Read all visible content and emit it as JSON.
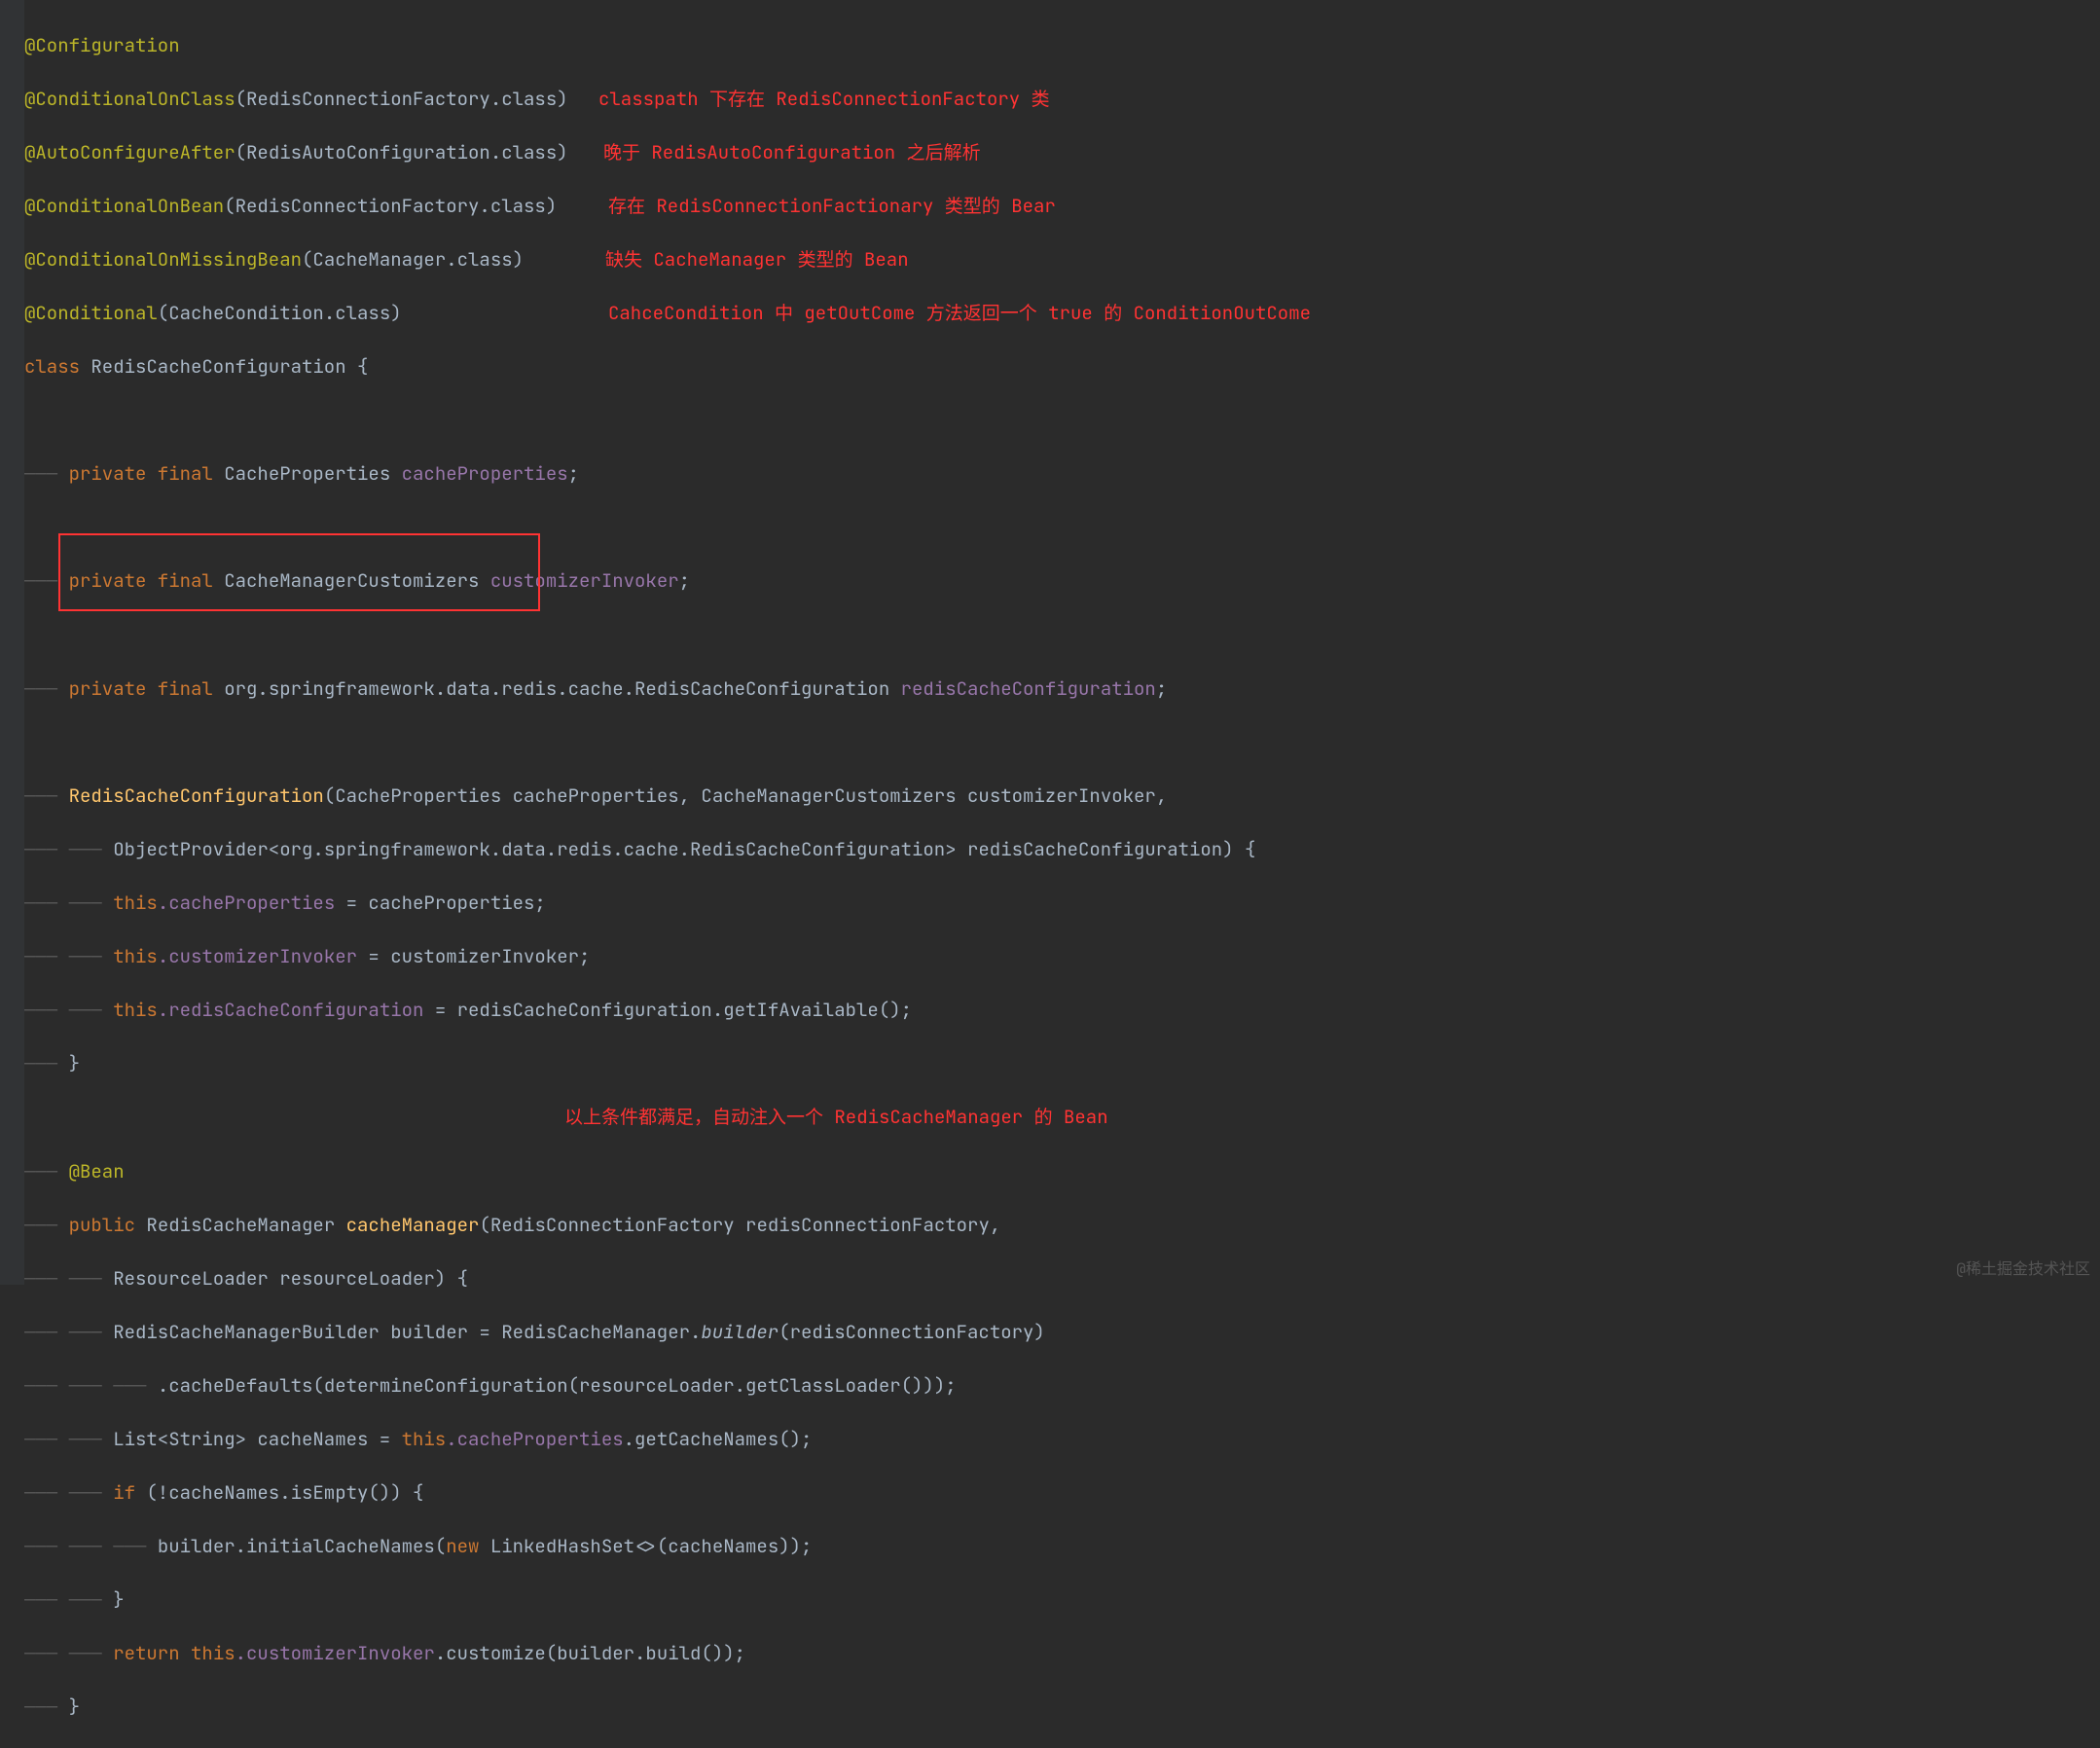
{
  "code": {
    "anno1": "@Configuration",
    "anno2": "@ConditionalOnClass",
    "anno2_arg_type": "RedisConnectionFactory",
    "anno3": "@AutoConfigureAfter",
    "anno3_arg_type": "RedisAutoConfiguration",
    "anno4": "@ConditionalOnBean",
    "anno4_arg_type": "RedisConnectionFactory",
    "anno5": "@ConditionalOnMissingBean",
    "anno5_arg_type": "CacheManager",
    "anno6": "@Conditional",
    "anno6_arg_type": "CacheCondition",
    "class_decl_kw": "class ",
    "class_decl_name": "RedisCacheConfiguration {",
    "field1_mods": "private final ",
    "field1_type": "CacheProperties ",
    "field1_name": "cacheProperties",
    "field2_mods": "private final ",
    "field2_type": "CacheManagerCustomizers ",
    "field2_name": "customizerInvoker",
    "field3_mods": "private final ",
    "field3_type": "org.springframework.data.redis.cache.RedisCacheConfiguration ",
    "field3_name": "redisCacheConfiguration",
    "ctor_name": "RedisCacheConfiguration",
    "ctor_params_l1": "(CacheProperties cacheProperties, CacheManagerCustomizers customizerInvoker,",
    "ctor_params_l2": "ObjectProvider<org.springframework.data.redis.cache.RedisCacheConfiguration> redisCacheConfiguration) {",
    "ctor_body1_this": "this",
    "ctor_body1_field": ".cacheProperties",
    "ctor_body1_rest": " = cacheProperties;",
    "ctor_body2_this": "this",
    "ctor_body2_field": ".customizerInvoker",
    "ctor_body2_rest": " = customizerInvoker;",
    "ctor_body3_this": "this",
    "ctor_body3_field": ".redisCacheConfiguration",
    "ctor_body3_rest": " = redisCacheConfiguration.getIfAvailable();",
    "close_brace": "}",
    "bean_anno": "@Bean",
    "method_mods": "public ",
    "method_ret": "RedisCacheManager ",
    "method_name": "cacheManager",
    "method_params1": "(RedisConnectionFactory redisConnectionFactory,",
    "method_params2": "ResourceLoader resourceLoader) {",
    "mbody1a": "RedisCacheManagerBuilder builder = RedisCacheManager.",
    "mbody1_builder": "builder",
    "mbody1b": "(redisConnectionFactory)",
    "mbody2": ".cacheDefaults(determineConfiguration(resourceLoader.getClassLoader()));",
    "mbody3a": "List<String> cacheNames = ",
    "mbody3_this": "this",
    "mbody3_field": ".cacheProperties",
    "mbody3b": ".getCacheNames();",
    "mbody4_if": "if ",
    "mbody4_cond": "(!cacheNames.isEmpty()) {",
    "mbody5a": "builder.initialCacheNames(",
    "mbody5_new": "new ",
    "mbody5b": "LinkedHashSet<>(cacheNames));",
    "mbody_return": "return ",
    "mbody_ret_this": "this",
    "mbody_ret_field": ".customizerInvoker",
    "mbody_ret_rest": ".customize(builder.build());",
    "dot_class": ".class",
    "paren_close": ")",
    "semi": ";"
  },
  "comments": {
    "c1": "classpath 下存在 RedisConnectionFactory 类",
    "c2": "晚于 RedisAutoConfiguration 之后解析",
    "c3": "存在 RedisConnectionFactionary 类型的 Bear",
    "c4": "缺失 CacheManager 类型的 Bean",
    "c5": "CahceCondition 中 getOutCome 方法返回一个 true 的 ConditionOutCome",
    "c6": "以上条件都满足，自动注入一个 RedisCacheManager 的 Bean"
  },
  "watermark": "@稀土掘金技术社区"
}
